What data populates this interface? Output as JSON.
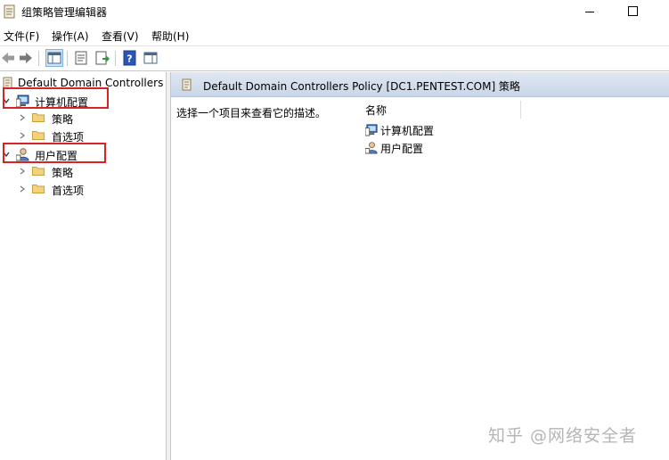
{
  "window": {
    "title": "组策略管理编辑器"
  },
  "menu": {
    "file": "文件(F)",
    "action": "操作(A)",
    "view": "查看(V)",
    "help": "帮助(H)"
  },
  "tree": {
    "root": "Default Domain Controllers P",
    "computer_config": "计算机配置",
    "user_config": "用户配置",
    "policies": "策略",
    "preferences": "首选项"
  },
  "right": {
    "header_title": "Default Domain Controllers Policy [DC1.PENTEST.COM] 策略",
    "description": "选择一个项目来查看它的描述。",
    "column_name": "名称",
    "items": [
      "计算机配置",
      "用户配置"
    ]
  },
  "watermark": "知乎 @网络安全者"
}
